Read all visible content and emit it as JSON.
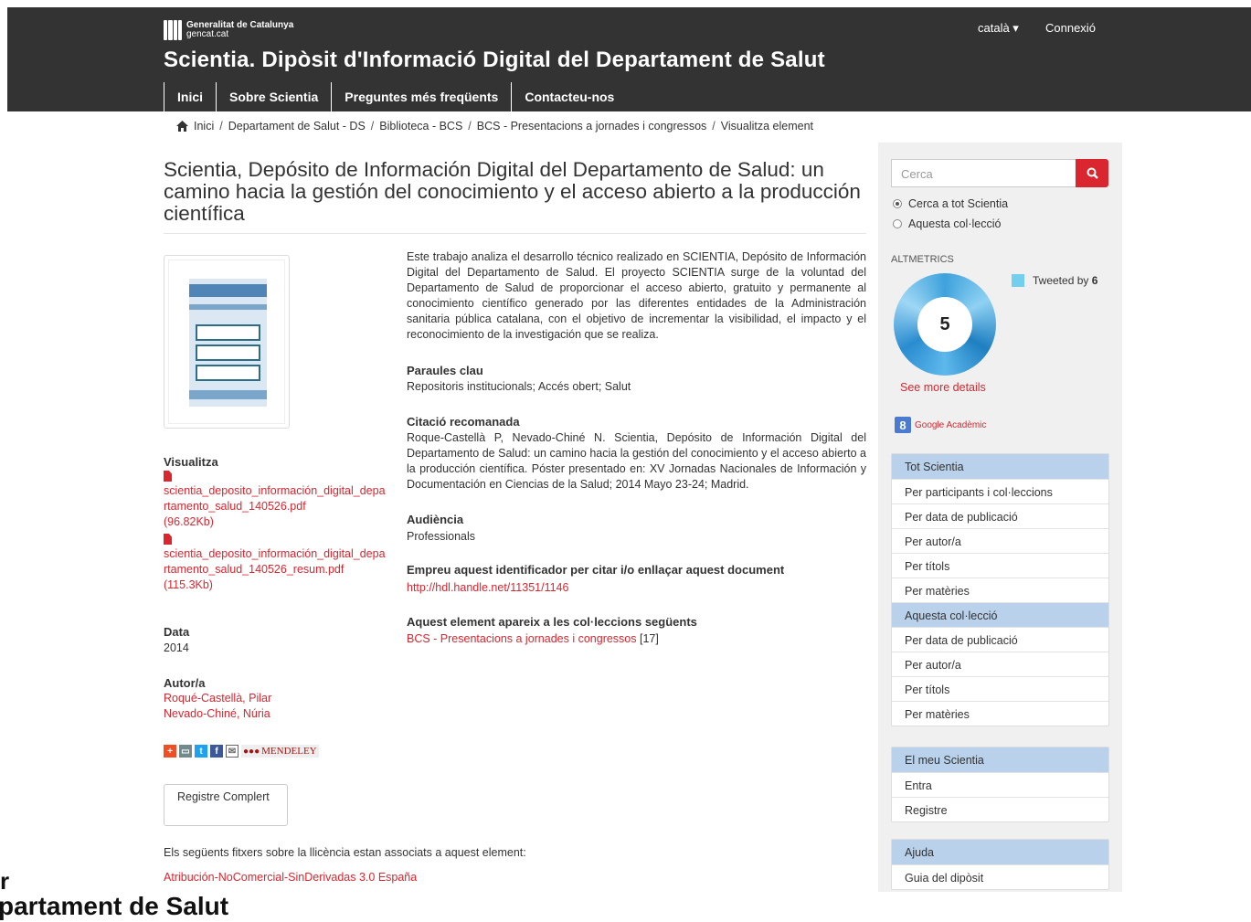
{
  "header": {
    "gencat_line1": "Generalitat de Catalunya",
    "gencat_line2": "gencat.cat",
    "site_title": "Scientia. Dipòsit d'Informació Digital del Departament de Salut",
    "language": "català ▾",
    "login": "Connexió",
    "nav": [
      "Inici",
      "Sobre Scientia",
      "Preguntes més freqüents",
      "Contacteu-nos"
    ]
  },
  "breadcrumb": [
    "Inici",
    "Departament de Salut - DS",
    "Biblioteca - BCS",
    "BCS - Presentacions a jornades i congressos",
    "Visualitza element"
  ],
  "item": {
    "title": "Scientia, Depósito de Información Digital del Departamento de Salud: un camino hacia la gestión del conocimiento y el acceso abierto a la producción científica",
    "abstract": "Este trabajo analiza el desarrollo técnico realizado en SCIENTIA, Depósito de Información Digital del Departamento de Salud. El proyecto SCIENTIA surge de la voluntad del Departamento de Salud de proporcionar el acceso abierto, gratuito y permanente al conocimiento científico generado por las diferentes entidades de la Administración sanitaria pública catalana, con el objetivo de incrementar la visibilidad, el impacto y el reconocimiento de la investigación que se realiza.",
    "keywords_label": "Paraules clau",
    "keywords": "Repositoris institucionals; Accés obert; Salut",
    "citation_label": "Citació recomanada",
    "citation": "Roque-Castellà P, Nevado-Chiné N. Scientia, Depósito de Información Digital del Departamento de Salud: un camino hacia la gestión del conocimiento y el acceso abierto a la producción científica. Póster presentado en: XV Jornadas Nacionales de Información y Documentación en Ciencias de la Salud; 2014 Mayo 23-24; Madrid.",
    "audience_label": "Audiència",
    "audience": "Professionals",
    "identifier_label": "Empreu aquest identificador per citar i/o enllaçar aquest document",
    "identifier": "http://hdl.handle.net/11351/1146",
    "collections_label": "Aquest element apareix a les col·leccions següents",
    "collection": "BCS - Presentacions a jornades i congressos",
    "collection_count": " [17]",
    "view_label": "Visualitza",
    "files": [
      {
        "name": "scientia_deposito_información_digital_departamento_salud_140526.pdf",
        "size": "(96.82Kb)"
      },
      {
        "name": "scientia_deposito_información_digital_departamento_salud_140526_resum.pdf",
        "size": "(115.3Kb)"
      }
    ],
    "date_label": "Data",
    "date": "2014",
    "author_label": "Autor/a",
    "authors": [
      "Roqué-Castellà, Pilar",
      "Nevado-Chiné, Núria"
    ],
    "mendeley": "MENDELEY",
    "full_record": "Registre Complert",
    "license_text": "Els següents fitxers sobre la llicència estan associats a aquest element:",
    "license_link": "Atribución-NoComercial-SinDerivadas 3.0 España"
  },
  "overlay_fragments": [
    "r",
    "partament de Salut"
  ],
  "sidebar": {
    "search_placeholder": "Cerca",
    "radio_all": "Cerca a tot Scientia",
    "radio_collection": "Aquesta col·lecció",
    "altmetrics_label": "ALTMETRICS",
    "altmetric_score": "5",
    "tweeted_prefix": "Tweeted by ",
    "tweeted_count": "6",
    "see_more": "See more details",
    "google_scholar": "Google Acadèmic",
    "tot_scientia": "Tot Scientia",
    "tot_items": [
      "Per participants i col·leccions",
      "Per data de publicació",
      "Per autor/a",
      "Per títols",
      "Per matèries"
    ],
    "collection_head": "Aquesta col·lecció",
    "collection_items": [
      "Per data de publicació",
      "Per autor/a",
      "Per títols",
      "Per matèries"
    ],
    "my_head": "El meu Scientia",
    "my_items": [
      "Entra",
      "Registre"
    ],
    "help_head": "Ajuda",
    "help_items": [
      "Guia del dipòsit"
    ]
  },
  "colors": {
    "accent": "#d9262f",
    "header_bg": "#333333",
    "panel_head": "#b9d1ea"
  }
}
